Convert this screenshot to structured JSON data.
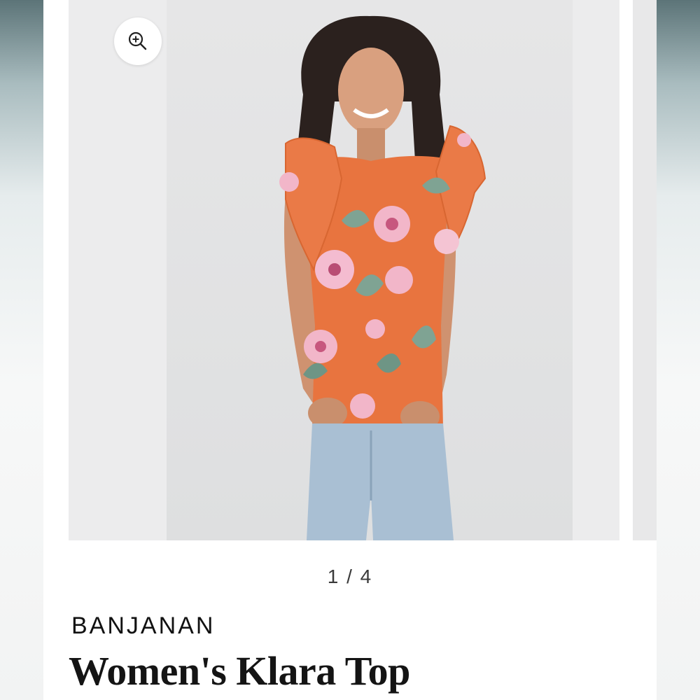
{
  "carousel": {
    "counter": "1 / 4",
    "zoom_icon": "zoom-in-icon"
  },
  "product": {
    "brand": "BANJANAN",
    "title": "Women's Klara Top"
  },
  "colors": {
    "top_print": "#e8743f",
    "flower_pink": "#f2b6c9",
    "leaf_green": "#7fa393",
    "denim": "#a9bfd3"
  }
}
